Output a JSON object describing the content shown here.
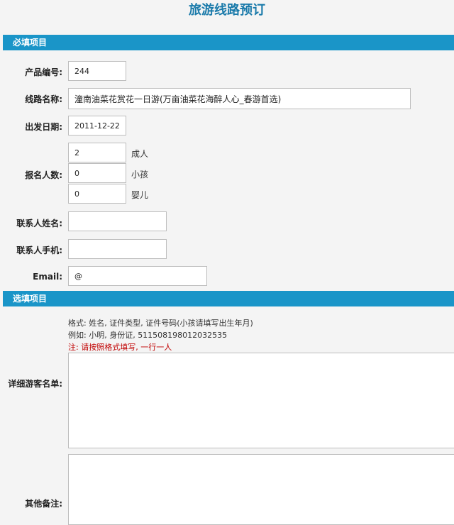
{
  "page_title": "旅游线路预订",
  "sections": {
    "required": "必填项目",
    "optional": "选填项目"
  },
  "fields": {
    "product_no": {
      "label": "产品编号:",
      "value": "244"
    },
    "route_name": {
      "label": "线路名称:",
      "value": "潼南油菜花赏花一日游(万亩油菜花海醉人心_春游首选)"
    },
    "depart_date": {
      "label": "出发日期:",
      "value": "2011-12-22"
    },
    "headcount": {
      "label": "报名人数:",
      "adult": {
        "value": "2",
        "unit": "成人"
      },
      "child": {
        "value": "0",
        "unit": "小孩"
      },
      "infant": {
        "value": "0",
        "unit": "婴儿"
      }
    },
    "contact_name": {
      "label": "联系人姓名:",
      "value": ""
    },
    "contact_phone": {
      "label": "联系人手机:",
      "value": ""
    },
    "email": {
      "label": "Email:",
      "value": "@"
    },
    "guest_list": {
      "label": "详细游客名单:",
      "hint_format": "格式: 姓名, 证件类型, 证件号码(小孩请填写出生年月)",
      "hint_example": "例如: 小明, 身份证, 511508198012032535",
      "hint_note": "注: 请按照格式填写, 一行一人",
      "value": ""
    },
    "remarks": {
      "label": "其他备注:",
      "value": ""
    }
  }
}
